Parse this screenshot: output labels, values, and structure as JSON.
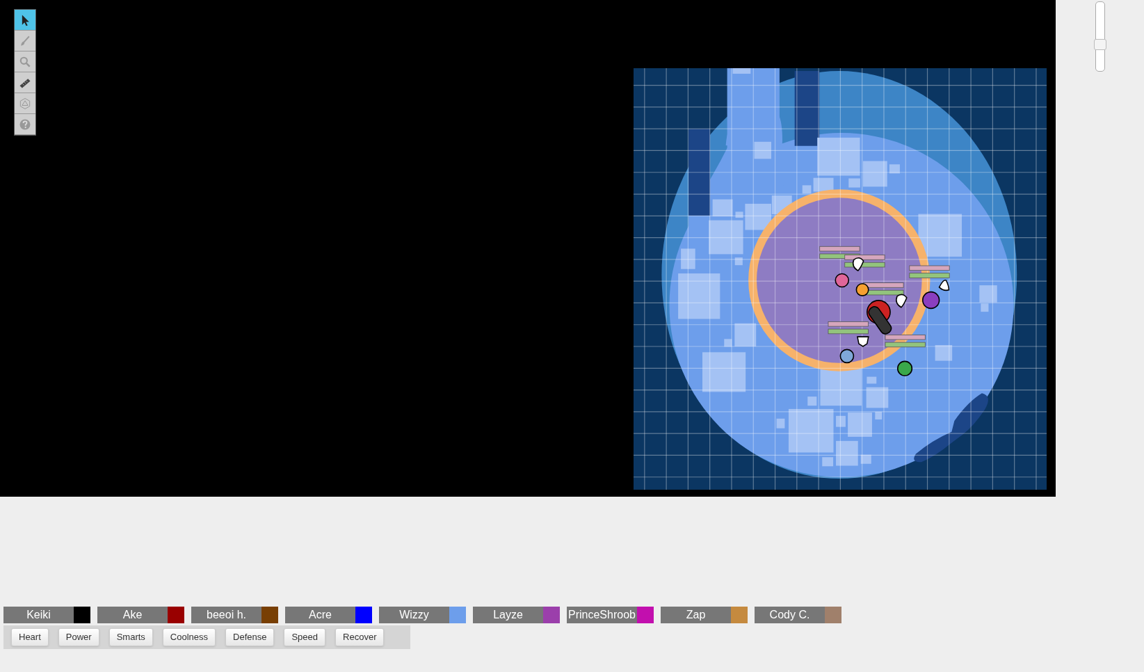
{
  "toolbar": [
    {
      "kind": "select",
      "selected": true
    },
    {
      "kind": "draw",
      "selected": false
    },
    {
      "kind": "zoom",
      "selected": false
    },
    {
      "kind": "measure",
      "selected": false
    },
    {
      "kind": "dice",
      "selected": false
    },
    {
      "kind": "help",
      "selected": false
    }
  ],
  "zoom_slider": {
    "level": 0.38
  },
  "players": [
    {
      "name": "Keiki",
      "color": "#000000"
    },
    {
      "name": "Ake",
      "color": "#990000"
    },
    {
      "name": "beeoi h.",
      "color": "#783f04"
    },
    {
      "name": "Acre",
      "color": "#0000ff"
    },
    {
      "name": "Wizzy",
      "color": "#6d9eeb"
    },
    {
      "name": "Layze",
      "color": "#9b3fab"
    },
    {
      "name": "PrinceShroob",
      "color": "#c20fae"
    },
    {
      "name": "Zap",
      "color": "#c58a3f"
    },
    {
      "name": "Cody C.",
      "color": "#a0806b"
    }
  ],
  "macro_buttons": [
    "Heart",
    "Power",
    "Smarts",
    "Coolness",
    "Defense",
    "Speed",
    "Recover"
  ]
}
